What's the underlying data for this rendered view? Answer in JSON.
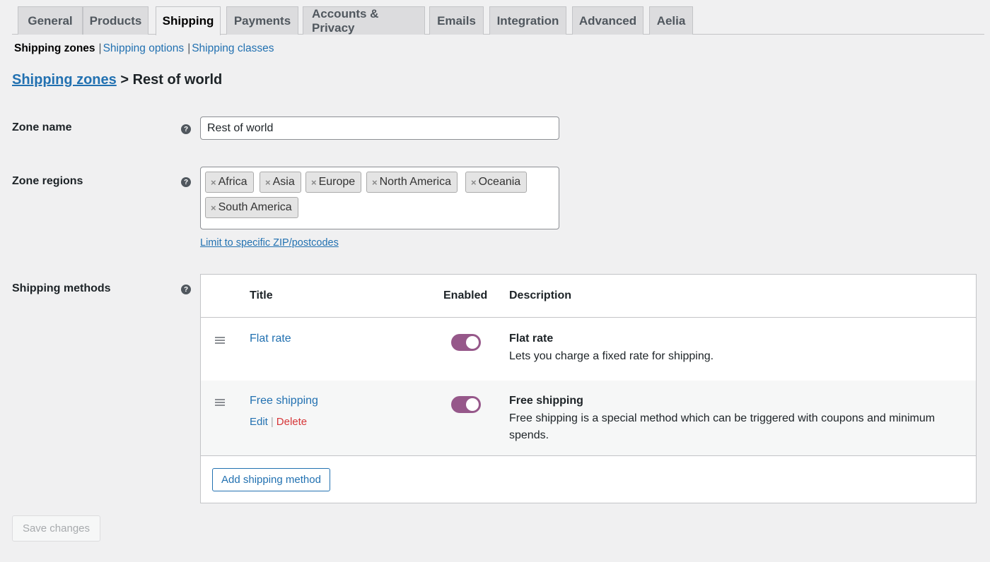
{
  "tabs": [
    {
      "label": "General",
      "active": false
    },
    {
      "label": "Products",
      "active": false
    },
    {
      "label": "Shipping",
      "active": true
    },
    {
      "label": "Payments",
      "active": false
    },
    {
      "label": "Accounts & Privacy",
      "active": false
    },
    {
      "label": "Emails",
      "active": false
    },
    {
      "label": "Integration",
      "active": false
    },
    {
      "label": "Advanced",
      "active": false
    },
    {
      "label": "Aelia",
      "active": false
    }
  ],
  "subnav": {
    "current": "Shipping zones",
    "separator": "|",
    "links": [
      "Shipping options",
      "Shipping classes"
    ]
  },
  "heading": {
    "link": "Shipping zones",
    "rest": " > Rest of world"
  },
  "form": {
    "zone_name_label": "Zone name",
    "zone_name_value": "Rest of world",
    "zone_regions_label": "Zone regions",
    "regions": [
      "Africa",
      "Asia",
      "Europe",
      "North America",
      "Oceania",
      "South America"
    ],
    "region_remove_glyph": "×",
    "limit_link": "Limit to specific ZIP/postcodes",
    "shipping_methods_label": "Shipping methods",
    "help_glyph": "?"
  },
  "methods_table": {
    "headers": {
      "title": "Title",
      "enabled": "Enabled",
      "description": "Description"
    },
    "rows": [
      {
        "title": "Flat rate",
        "enabled": true,
        "desc_title": "Flat rate",
        "desc_text": "Lets you charge a fixed rate for shipping."
      },
      {
        "title": "Free shipping",
        "enabled": true,
        "edit": "Edit",
        "delete": "Delete",
        "action_separator": "|",
        "desc_title": "Free shipping",
        "desc_text": "Free shipping is a special method which can be triggered with coupons and minimum spends."
      }
    ],
    "add_button": "Add shipping method"
  },
  "save_button": "Save changes",
  "colors": {
    "accent": "#96588a",
    "link": "#2271b1",
    "delete": "#d63638"
  }
}
